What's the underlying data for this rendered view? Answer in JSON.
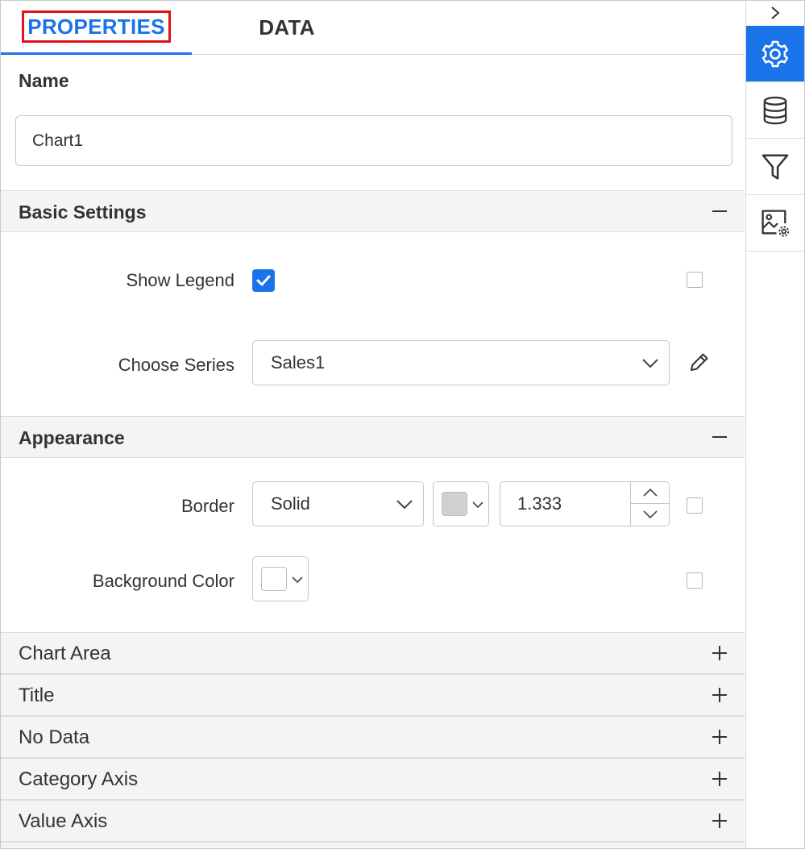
{
  "tabs": {
    "properties_label": "PROPERTIES",
    "data_label": "DATA",
    "active": "properties"
  },
  "name": {
    "label": "Name",
    "value": "Chart1"
  },
  "basic_settings": {
    "title": "Basic Settings",
    "toggle": "collapse",
    "show_legend_label": "Show Legend",
    "show_legend_checked": true,
    "choose_series_label": "Choose Series",
    "choose_series_value": "Sales1"
  },
  "appearance": {
    "title": "Appearance",
    "toggle": "collapse",
    "border_label": "Border",
    "border_style_value": "Solid",
    "border_color": "#d0d0d0",
    "border_width_value": "1.333",
    "background_color_label": "Background Color",
    "background_color": "#ffffff"
  },
  "collapsed_sections": [
    {
      "title": "Chart Area"
    },
    {
      "title": "Title"
    },
    {
      "title": "No Data"
    },
    {
      "title": "Category Axis"
    },
    {
      "title": "Value Axis"
    }
  ],
  "rail": {
    "icons": [
      "chevron-right-icon",
      "gear-icon",
      "database-icon",
      "filter-icon",
      "image-settings-icon"
    ],
    "active": "gear-icon"
  },
  "colors": {
    "accent": "#1a73e8",
    "highlight_box": "#e0121c",
    "section_bg": "#f4f4f4"
  }
}
